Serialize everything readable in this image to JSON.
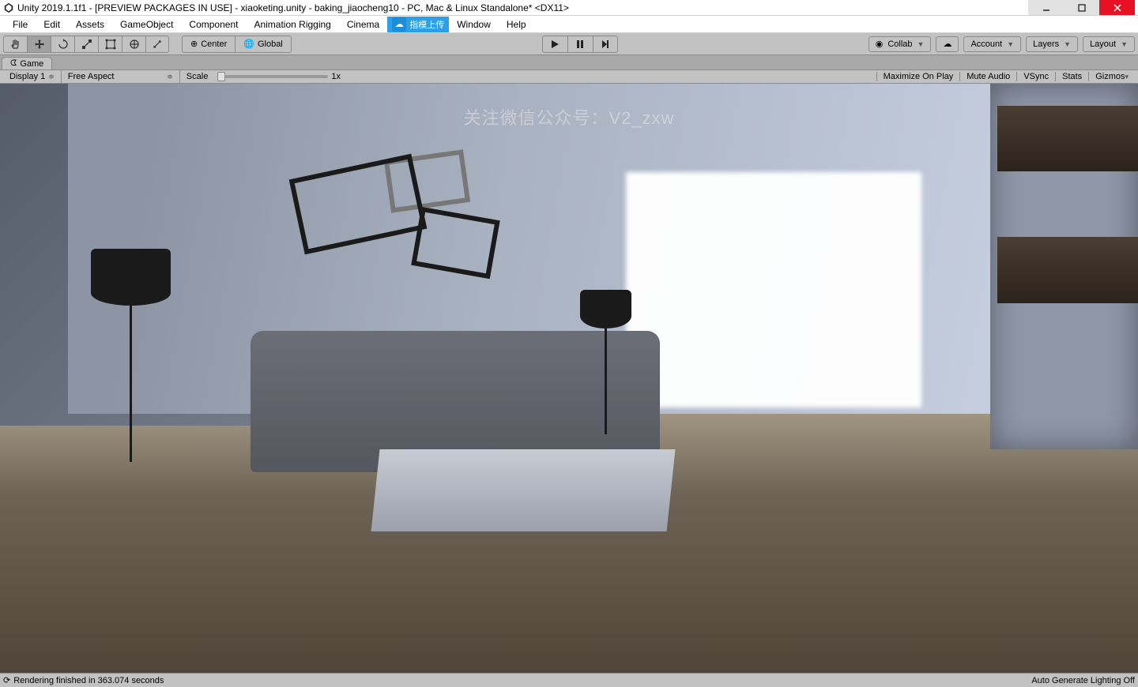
{
  "title": "Unity 2019.1.1f1 - [PREVIEW PACKAGES IN USE] - xiaoketing.unity - baking_jiaocheng10 - PC, Mac & Linux Standalone* <DX11>",
  "menu": {
    "file": "File",
    "edit": "Edit",
    "assets": "Assets",
    "gameobject": "GameObject",
    "component": "Component",
    "animation_rigging": "Animation Rigging",
    "cinema": "Cinema",
    "blue_label": "指模上传",
    "window": "Window",
    "help": "Help"
  },
  "toolbar": {
    "pivot_center": "Center",
    "pivot_global": "Global",
    "collab": "Collab",
    "account": "Account",
    "layers": "Layers",
    "layout": "Layout"
  },
  "tab": {
    "game": "Game"
  },
  "game_opts": {
    "display": "Display 1",
    "aspect": "Free Aspect",
    "scale_label": "Scale",
    "scale_value": "1x",
    "maximize": "Maximize On Play",
    "mute": "Mute Audio",
    "vsync": "VSync",
    "stats": "Stats",
    "gizmos": "Gizmos"
  },
  "watermark": "关注微信公众号：V2_zxw",
  "status": {
    "left": "Rendering finished in 363.074 seconds",
    "right": "Auto Generate Lighting Off"
  }
}
